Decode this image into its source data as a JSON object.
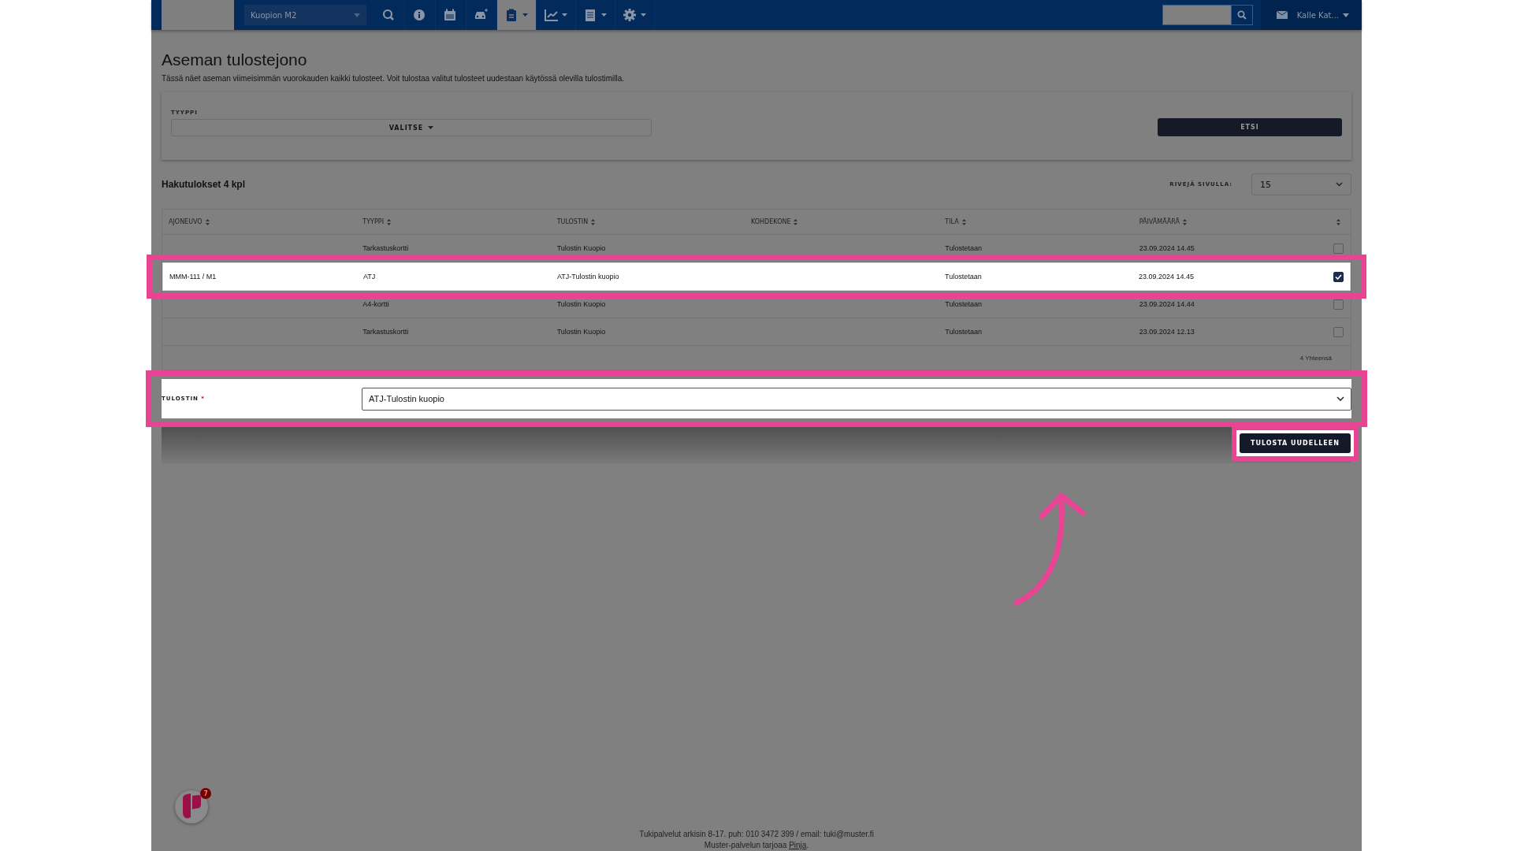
{
  "nav": {
    "location": "Kuopion M2",
    "items": [
      {
        "kind": "search",
        "selected": false,
        "caret": false
      },
      {
        "kind": "info",
        "selected": false,
        "caret": false
      },
      {
        "kind": "calendar",
        "selected": false,
        "caret": false
      },
      {
        "kind": "car",
        "selected": false,
        "caret": false
      },
      {
        "kind": "clipboard",
        "selected": true,
        "caret": true
      },
      {
        "kind": "chart",
        "selected": false,
        "caret": true
      },
      {
        "kind": "document",
        "selected": false,
        "caret": true
      },
      {
        "kind": "gear",
        "selected": false,
        "caret": true
      }
    ],
    "user": "Kalle Kat..."
  },
  "page": {
    "title": "Aseman tulostejono",
    "description": "Tässä näet aseman viimeisimmän vuorokauden kaikki tulosteet. Voit tulostaa valitut tulosteet uudestaan käytössä olevilla tulostimilla.",
    "filter": {
      "label": "TYYPPI",
      "select": "VALITSE",
      "button": "ETSI"
    },
    "results_title": "Hakutulokset 4 kpl",
    "rows_per_page": {
      "label": "RIVEJÄ SIVULLA:",
      "value": "15"
    },
    "table": {
      "columns": [
        "AJONEUVO",
        "TYYPPI",
        "TULOSTIN",
        "KOHDEKONE",
        "TILA",
        "PÄIVÄMÄÄRÄ"
      ],
      "rows": [
        {
          "cells": [
            "",
            "Tarkastuskortti",
            "Tulostin Kuopio",
            "",
            "Tulostetaan",
            "23.09.2024 14.45"
          ],
          "checked": false,
          "highlighted": false
        },
        {
          "cells": [
            "MMM-111 / M1",
            "ATJ",
            "ATJ-Tulostin kuopio",
            "",
            "Tulostetaan",
            "23.09.2024 14.45"
          ],
          "checked": true,
          "highlighted": true
        },
        {
          "cells": [
            "",
            "A4-kortti",
            "Tulostin Kuopio",
            "",
            "Tulostetaan",
            "23.09.2024 14.44"
          ],
          "checked": false,
          "highlighted": false
        },
        {
          "cells": [
            "",
            "Tarkastuskortti",
            "Tulostin Kuopio",
            "",
            "Tulostetaan",
            "23.09.2024 12.13"
          ],
          "checked": false,
          "highlighted": false
        }
      ],
      "total": "4 Yhteensä"
    },
    "printer": {
      "label": "TULOSTIN",
      "required_mark": "*",
      "value": "ATJ-Tulostin kuopio"
    },
    "reprint_button": "TULOSTA UUDELLEEN"
  },
  "footer": {
    "line1": "Tukipalvelut arkisin 8-17. puh: 010 3472 399 / email: tuki@muster.fi",
    "line2_text": "Muster-palvelun tarjoaa ",
    "line2_link": "Pinja",
    "line2_end": "."
  },
  "chat": {
    "badge": "7"
  }
}
